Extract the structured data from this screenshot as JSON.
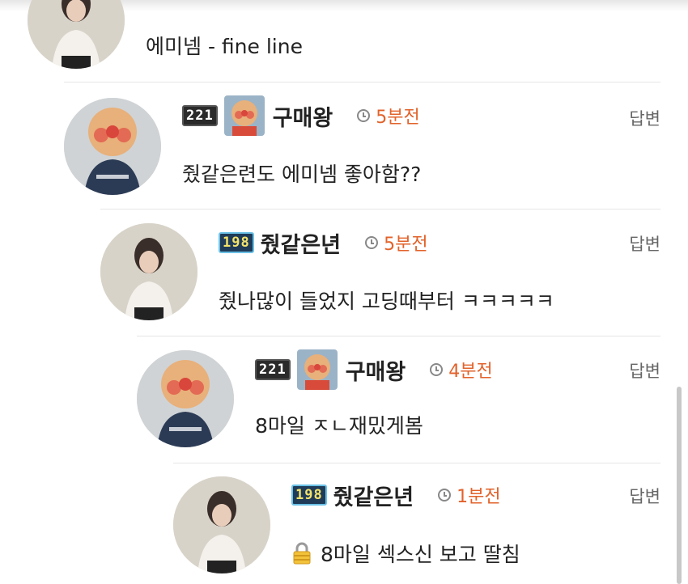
{
  "reply_label": "답변",
  "colors": {
    "time": "#e2622a",
    "nick": "#222222",
    "divider": "#e6e6e6"
  },
  "comments": [
    {
      "text": "에미넴 - fine line"
    },
    {
      "level": "221",
      "nick": "구매왕",
      "time": "5분전",
      "text": "줬같은련도 에미넴 좋아함??"
    },
    {
      "level": "198",
      "nick": "줬같은년",
      "time": "5분전",
      "text": "줬나많이 들었지 고딩때부터 ㅋㅋㅋㅋㅋ"
    },
    {
      "level": "221",
      "nick": "구매왕",
      "time": "4분전",
      "text": "8마일 ㅈㄴ재밌게봄"
    },
    {
      "level": "198",
      "nick": "줬같은년",
      "time": "1분전",
      "text": "8마일 섹스신 보고 딸침",
      "icon": "lock-icon"
    }
  ]
}
